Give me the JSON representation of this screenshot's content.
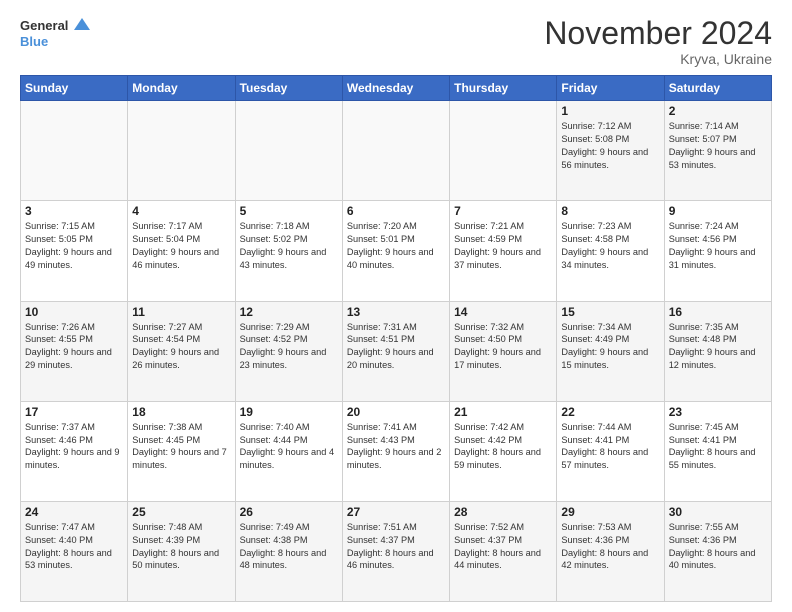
{
  "logo": {
    "line1": "General",
    "line2": "Blue"
  },
  "title": "November 2024",
  "subtitle": "Kryva, Ukraine",
  "days_header": [
    "Sunday",
    "Monday",
    "Tuesday",
    "Wednesday",
    "Thursday",
    "Friday",
    "Saturday"
  ],
  "weeks": [
    [
      {
        "day": "",
        "info": ""
      },
      {
        "day": "",
        "info": ""
      },
      {
        "day": "",
        "info": ""
      },
      {
        "day": "",
        "info": ""
      },
      {
        "day": "",
        "info": ""
      },
      {
        "day": "1",
        "info": "Sunrise: 7:12 AM\nSunset: 5:08 PM\nDaylight: 9 hours and 56 minutes."
      },
      {
        "day": "2",
        "info": "Sunrise: 7:14 AM\nSunset: 5:07 PM\nDaylight: 9 hours and 53 minutes."
      }
    ],
    [
      {
        "day": "3",
        "info": "Sunrise: 7:15 AM\nSunset: 5:05 PM\nDaylight: 9 hours and 49 minutes."
      },
      {
        "day": "4",
        "info": "Sunrise: 7:17 AM\nSunset: 5:04 PM\nDaylight: 9 hours and 46 minutes."
      },
      {
        "day": "5",
        "info": "Sunrise: 7:18 AM\nSunset: 5:02 PM\nDaylight: 9 hours and 43 minutes."
      },
      {
        "day": "6",
        "info": "Sunrise: 7:20 AM\nSunset: 5:01 PM\nDaylight: 9 hours and 40 minutes."
      },
      {
        "day": "7",
        "info": "Sunrise: 7:21 AM\nSunset: 4:59 PM\nDaylight: 9 hours and 37 minutes."
      },
      {
        "day": "8",
        "info": "Sunrise: 7:23 AM\nSunset: 4:58 PM\nDaylight: 9 hours and 34 minutes."
      },
      {
        "day": "9",
        "info": "Sunrise: 7:24 AM\nSunset: 4:56 PM\nDaylight: 9 hours and 31 minutes."
      }
    ],
    [
      {
        "day": "10",
        "info": "Sunrise: 7:26 AM\nSunset: 4:55 PM\nDaylight: 9 hours and 29 minutes."
      },
      {
        "day": "11",
        "info": "Sunrise: 7:27 AM\nSunset: 4:54 PM\nDaylight: 9 hours and 26 minutes."
      },
      {
        "day": "12",
        "info": "Sunrise: 7:29 AM\nSunset: 4:52 PM\nDaylight: 9 hours and 23 minutes."
      },
      {
        "day": "13",
        "info": "Sunrise: 7:31 AM\nSunset: 4:51 PM\nDaylight: 9 hours and 20 minutes."
      },
      {
        "day": "14",
        "info": "Sunrise: 7:32 AM\nSunset: 4:50 PM\nDaylight: 9 hours and 17 minutes."
      },
      {
        "day": "15",
        "info": "Sunrise: 7:34 AM\nSunset: 4:49 PM\nDaylight: 9 hours and 15 minutes."
      },
      {
        "day": "16",
        "info": "Sunrise: 7:35 AM\nSunset: 4:48 PM\nDaylight: 9 hours and 12 minutes."
      }
    ],
    [
      {
        "day": "17",
        "info": "Sunrise: 7:37 AM\nSunset: 4:46 PM\nDaylight: 9 hours and 9 minutes."
      },
      {
        "day": "18",
        "info": "Sunrise: 7:38 AM\nSunset: 4:45 PM\nDaylight: 9 hours and 7 minutes."
      },
      {
        "day": "19",
        "info": "Sunrise: 7:40 AM\nSunset: 4:44 PM\nDaylight: 9 hours and 4 minutes."
      },
      {
        "day": "20",
        "info": "Sunrise: 7:41 AM\nSunset: 4:43 PM\nDaylight: 9 hours and 2 minutes."
      },
      {
        "day": "21",
        "info": "Sunrise: 7:42 AM\nSunset: 4:42 PM\nDaylight: 8 hours and 59 minutes."
      },
      {
        "day": "22",
        "info": "Sunrise: 7:44 AM\nSunset: 4:41 PM\nDaylight: 8 hours and 57 minutes."
      },
      {
        "day": "23",
        "info": "Sunrise: 7:45 AM\nSunset: 4:41 PM\nDaylight: 8 hours and 55 minutes."
      }
    ],
    [
      {
        "day": "24",
        "info": "Sunrise: 7:47 AM\nSunset: 4:40 PM\nDaylight: 8 hours and 53 minutes."
      },
      {
        "day": "25",
        "info": "Sunrise: 7:48 AM\nSunset: 4:39 PM\nDaylight: 8 hours and 50 minutes."
      },
      {
        "day": "26",
        "info": "Sunrise: 7:49 AM\nSunset: 4:38 PM\nDaylight: 8 hours and 48 minutes."
      },
      {
        "day": "27",
        "info": "Sunrise: 7:51 AM\nSunset: 4:37 PM\nDaylight: 8 hours and 46 minutes."
      },
      {
        "day": "28",
        "info": "Sunrise: 7:52 AM\nSunset: 4:37 PM\nDaylight: 8 hours and 44 minutes."
      },
      {
        "day": "29",
        "info": "Sunrise: 7:53 AM\nSunset: 4:36 PM\nDaylight: 8 hours and 42 minutes."
      },
      {
        "day": "30",
        "info": "Sunrise: 7:55 AM\nSunset: 4:36 PM\nDaylight: 8 hours and 40 minutes."
      }
    ]
  ]
}
